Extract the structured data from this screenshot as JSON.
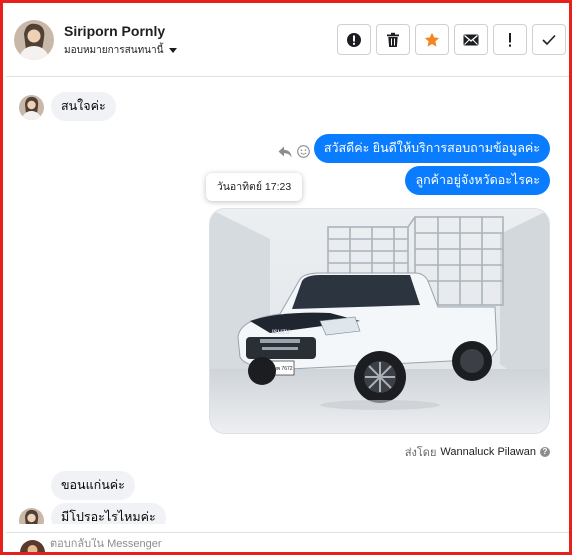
{
  "header": {
    "contact_name": "Siriporn Pornly",
    "assign_label": "มอบหมายการสนทนานี้",
    "tools": [
      {
        "icon": "alert-circle-icon"
      },
      {
        "icon": "trash-icon"
      },
      {
        "icon": "star-icon"
      },
      {
        "icon": "mail-icon"
      },
      {
        "icon": "exclamation-icon"
      },
      {
        "icon": "check-icon"
      }
    ]
  },
  "messages": {
    "incoming_1": "สนใจค่ะ",
    "outgoing_1": "สวัสดีค่ะ ยินดีให้บริการสอบถามข้อมูลค่ะ",
    "outgoing_2": "ลูกค้าอยู่จังหวัดอะไรคะ",
    "timestamp_tooltip": "วันอาทิตย์ 17:23",
    "incoming_2": "ขอนแก่นค่ะ",
    "incoming_3": "มีโปรอะไรไหมค่ะ"
  },
  "photo": {
    "plate_text": "3ฒพ 7672",
    "brand_text": "ISUZU"
  },
  "sent_by": {
    "prefix": "ส่งโดย",
    "agent": "Wannaluck Pilawan"
  },
  "composer": {
    "placeholder": "ตอบกลับใน Messenger"
  },
  "colors": {
    "frame": "#e8201c",
    "outgoing_bubble": "#0a7cff",
    "incoming_bubble": "#f0f2f5",
    "star": "#f5831f"
  }
}
